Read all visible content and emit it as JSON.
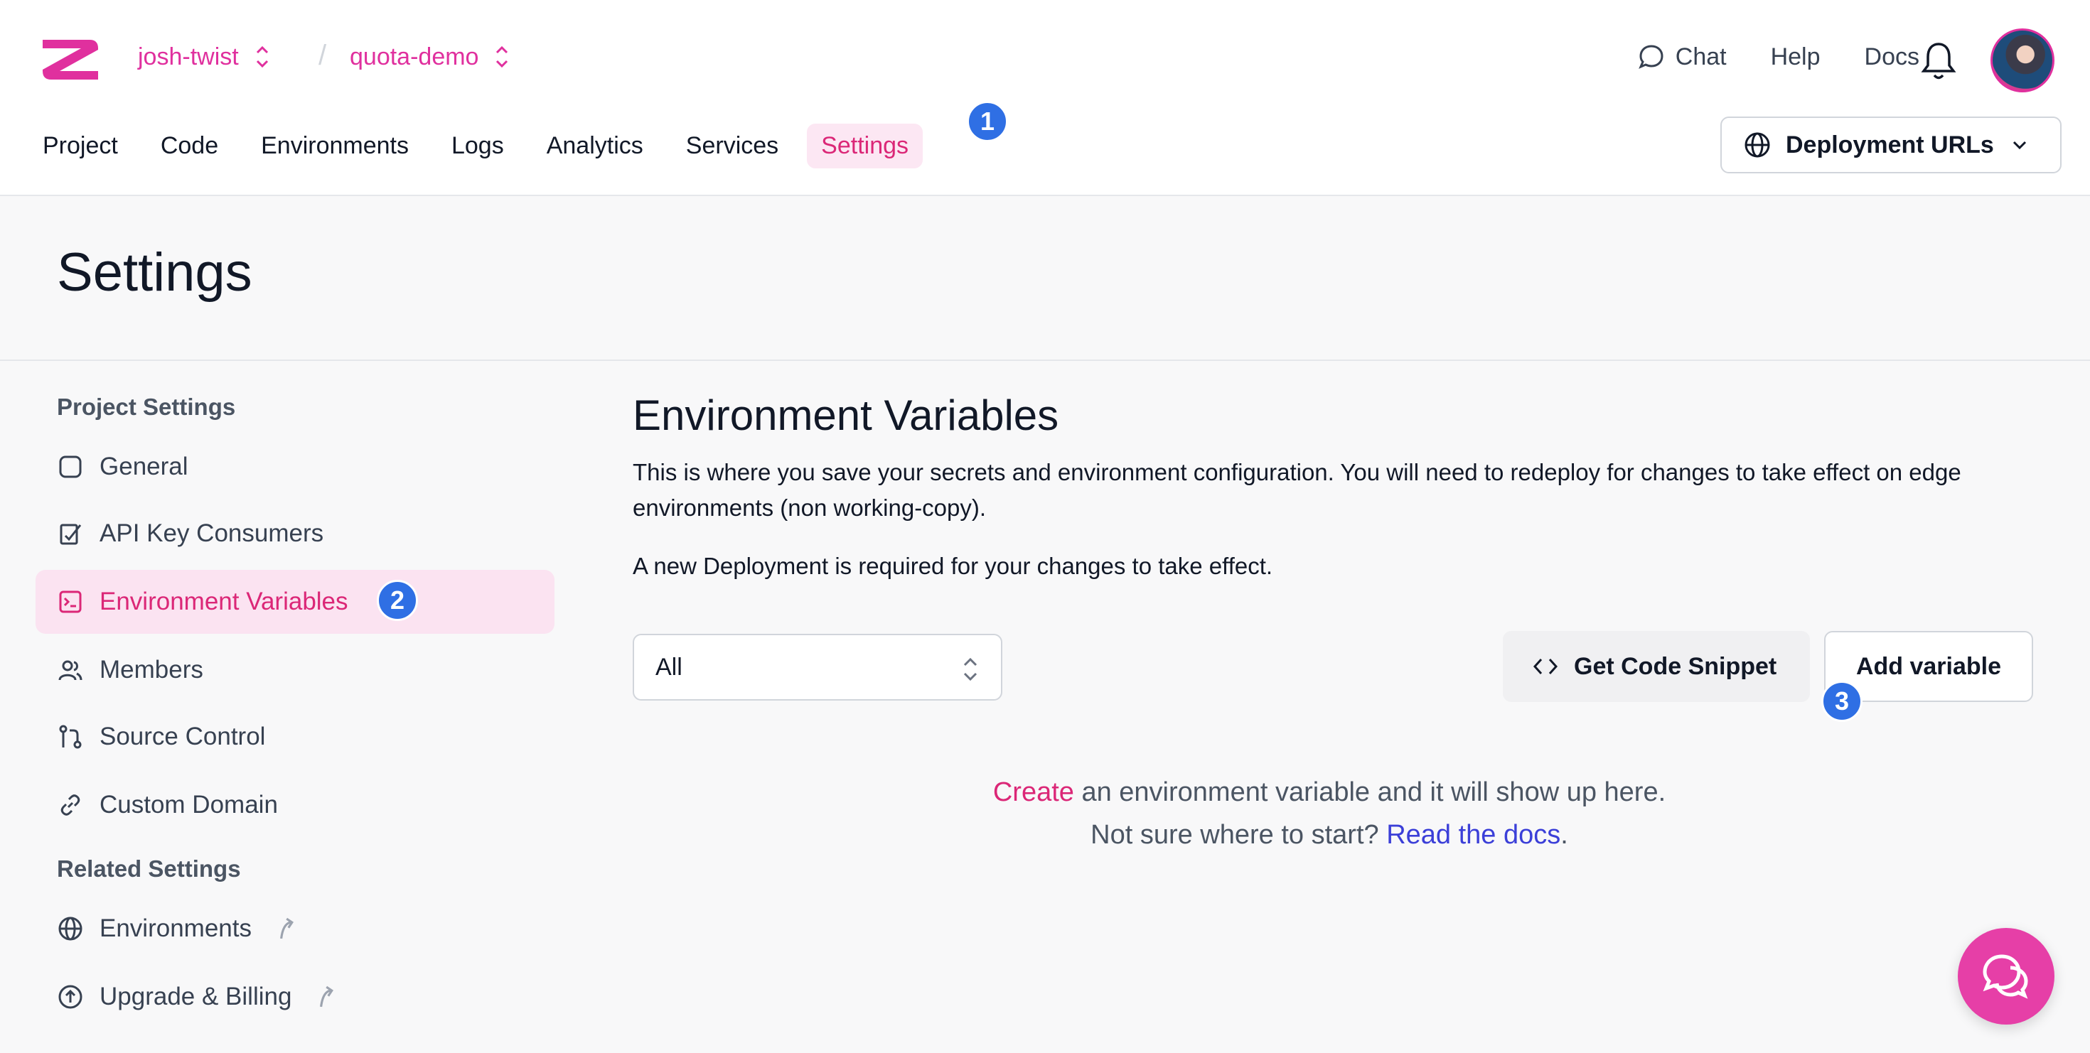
{
  "header": {
    "org": "josh-twist",
    "project": "quota-demo",
    "separator": "/",
    "links": {
      "chat": "Chat",
      "help": "Help",
      "docs": "Docs"
    },
    "accent": "#e0309e"
  },
  "tabs": [
    {
      "label": "Project"
    },
    {
      "label": "Code"
    },
    {
      "label": "Environments"
    },
    {
      "label": "Logs"
    },
    {
      "label": "Analytics"
    },
    {
      "label": "Services"
    },
    {
      "label": "Settings",
      "active": true
    }
  ],
  "badges": [
    "1",
    "2",
    "3"
  ],
  "deploy_button": "Deployment URLs",
  "page_title": "Settings",
  "sidebar": {
    "project_heading": "Project Settings",
    "project_items": [
      {
        "label": "General",
        "icon": "square-icon"
      },
      {
        "label": "API Key Consumers",
        "icon": "key-consumer-icon"
      },
      {
        "label": "Environment Variables",
        "icon": "terminal-icon",
        "active": true
      },
      {
        "label": "Members",
        "icon": "users-icon"
      },
      {
        "label": "Source Control",
        "icon": "git-pull-icon"
      },
      {
        "label": "Custom Domain",
        "icon": "link-icon"
      }
    ],
    "related_heading": "Related Settings",
    "related_items": [
      {
        "label": "Environments",
        "icon": "globe-icon"
      },
      {
        "label": "Upgrade & Billing",
        "icon": "arrow-up-circle-icon"
      }
    ]
  },
  "content": {
    "title": "Environment Variables",
    "description": "This is where you save your secrets and environment configuration. You will need to redeploy for changes to take effect on edge environments (non working-copy).",
    "notice": "A new Deployment is required for your changes to take effect.",
    "filter_value": "All",
    "snippet_button": "Get Code Snippet",
    "add_button": "Add variable",
    "empty_create": "Create",
    "empty_line1_rest": " an environment variable and it will show up here.",
    "empty_line2_prefix": "Not sure where to start? ",
    "empty_docs_link": "Read the docs",
    "empty_line2_suffix": "."
  }
}
